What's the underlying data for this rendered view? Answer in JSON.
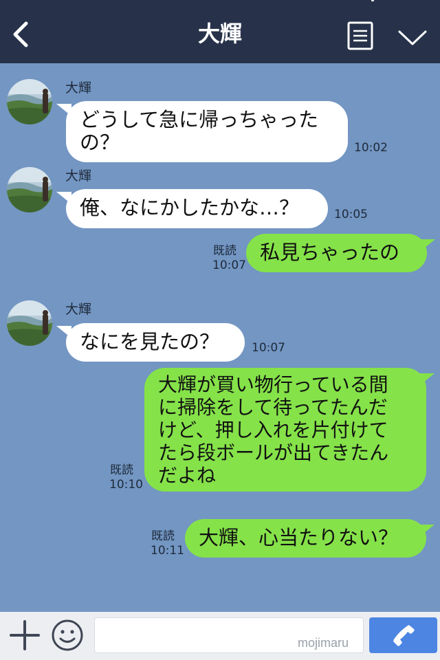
{
  "header": {
    "title": "大輝",
    "background": "#27324a",
    "icons": [
      "back-chevron-icon",
      "menu-list-icon",
      "chevron-down-icon"
    ]
  },
  "chat": {
    "background": "#7396c3",
    "colors": {
      "incoming_bubble": "#ffffff",
      "outgoing_bubble": "#85e249"
    },
    "messages": [
      {
        "direction": "in",
        "sender": "大輝",
        "text": "どうして急に帰っちゃった\nの？",
        "time": "10:02"
      },
      {
        "direction": "in",
        "sender": "大輝",
        "text": "俺、なにかしたかな…？",
        "time": "10:05"
      },
      {
        "direction": "out",
        "read": "既読",
        "text": "私見ちゃったの",
        "time": "10:07"
      },
      {
        "direction": "in",
        "sender": "大輝",
        "text": "なにを見たの？",
        "time": "10:07"
      },
      {
        "direction": "out",
        "read": "既読",
        "text": "大輝が買い物行っている間\nに掃除をして待ってたんだ\nけど、押し入れを片付けて\nたら段ボールが出てきたん\nだよね",
        "time": "10:10"
      },
      {
        "direction": "out",
        "read": "既読",
        "text": "大輝、心当たりない？",
        "time": "10:11"
      }
    ]
  },
  "input_bar": {
    "watermark": "mojimaru",
    "icons": [
      "plus-icon",
      "smile-icon",
      "phone-icon"
    ],
    "send_color": "#4d86e2"
  }
}
